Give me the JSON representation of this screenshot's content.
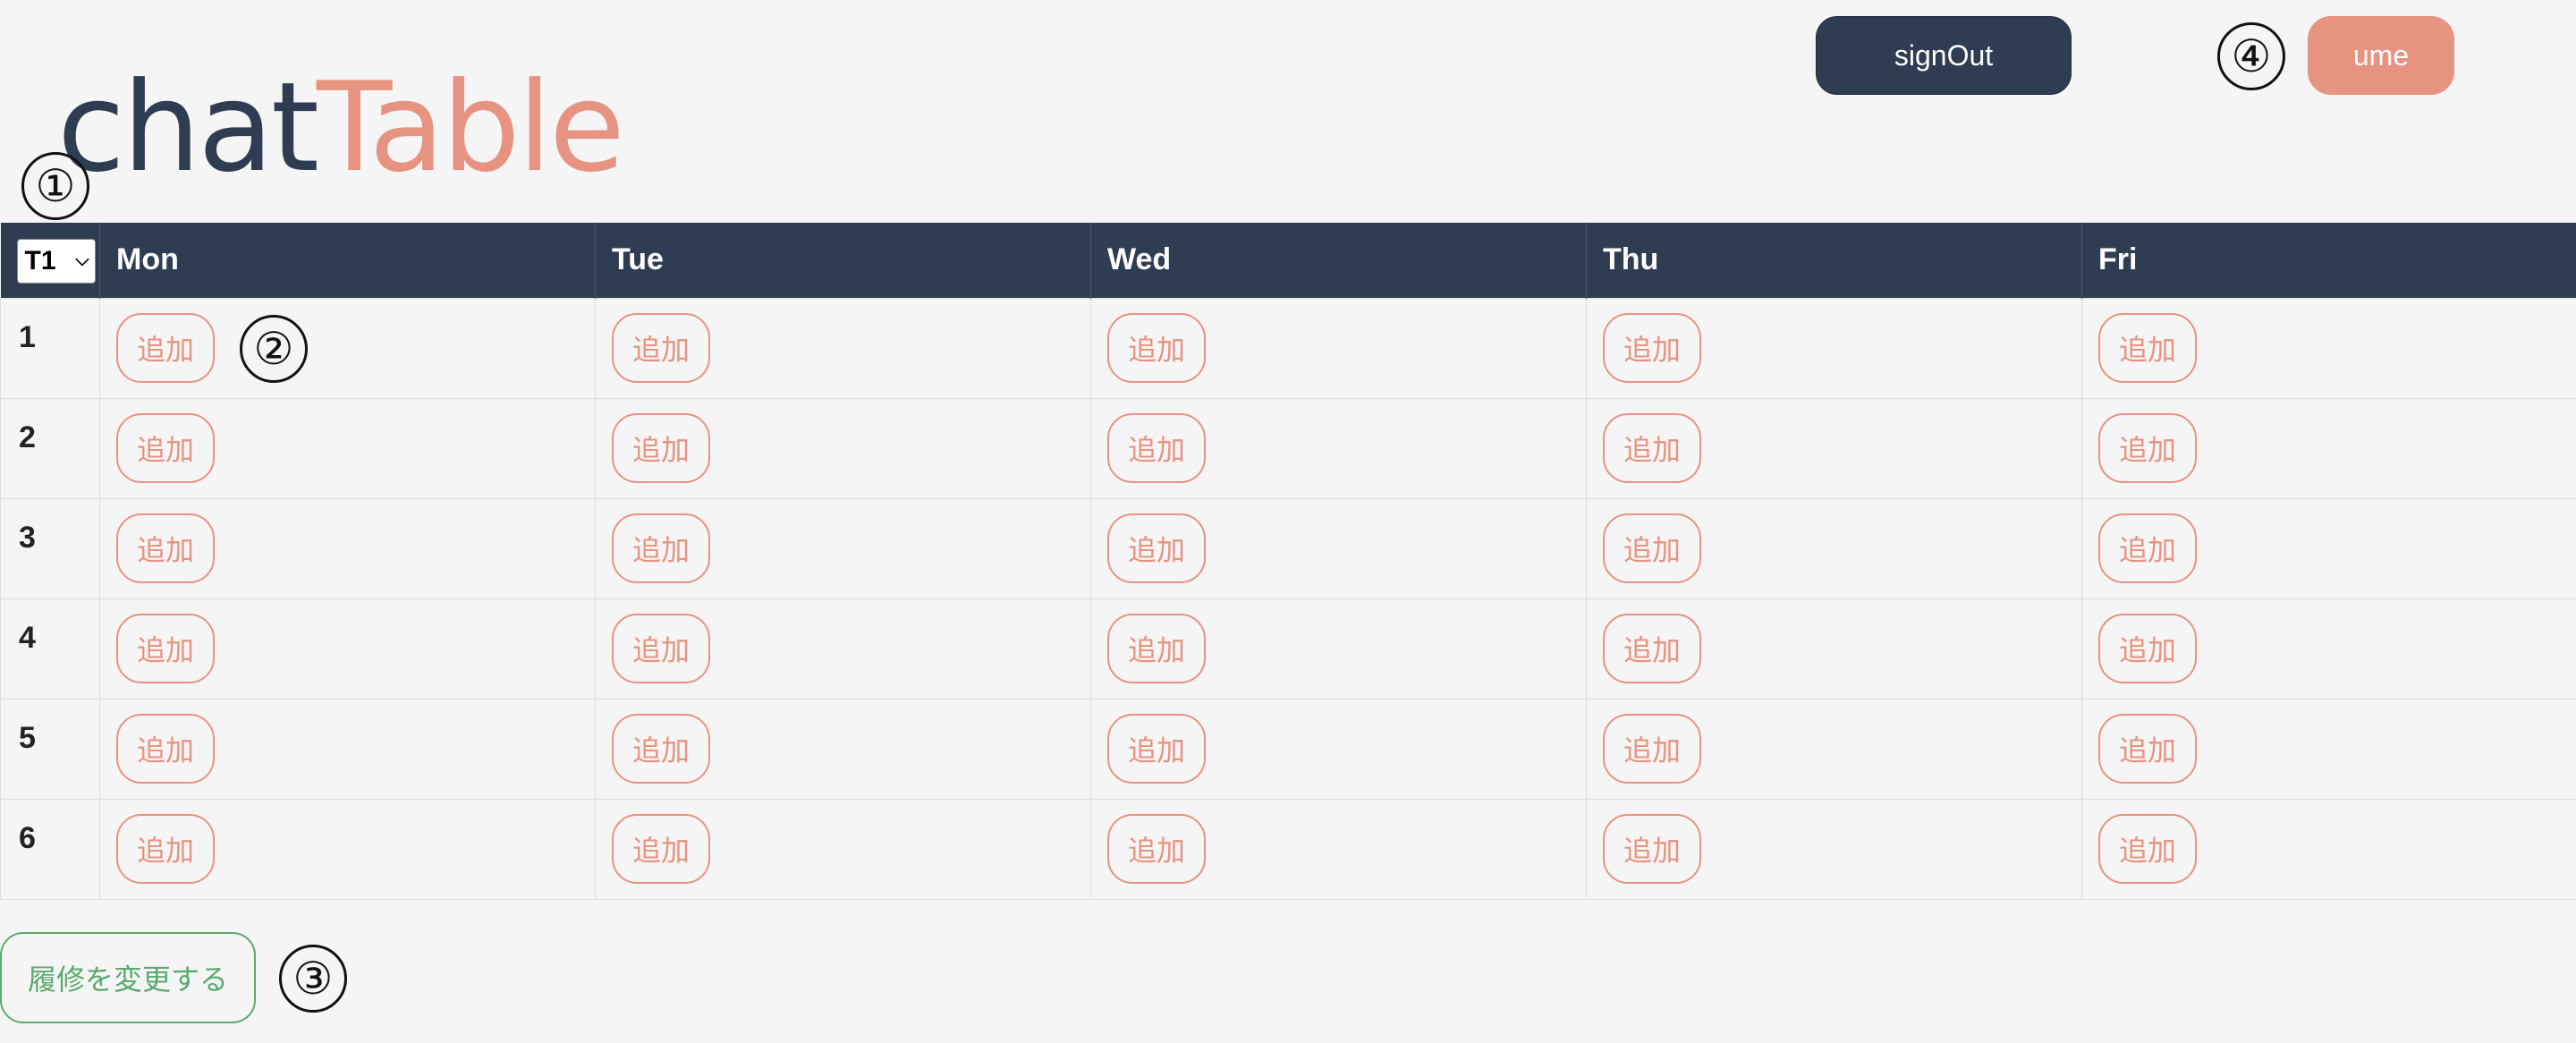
{
  "header": {
    "logo_part1": "chat",
    "logo_part2": "Table",
    "signout_label": "signOut",
    "user_label": "ume"
  },
  "markers": [
    "①",
    "②",
    "③",
    "④"
  ],
  "table": {
    "term_value": "T1",
    "days": [
      "Mon",
      "Tue",
      "Wed",
      "Thu",
      "Fri"
    ],
    "periods": [
      "1",
      "2",
      "3",
      "4",
      "5",
      "6"
    ],
    "add_label": "追加"
  },
  "footer": {
    "change_label": "履修を変更する"
  },
  "colors": {
    "navy": "#2e3d52",
    "coral": "#e79381",
    "green": "#5aa96e",
    "background": "#f5f5f5"
  },
  "icons": {
    "select_chevron": "chevron-down-icon"
  }
}
